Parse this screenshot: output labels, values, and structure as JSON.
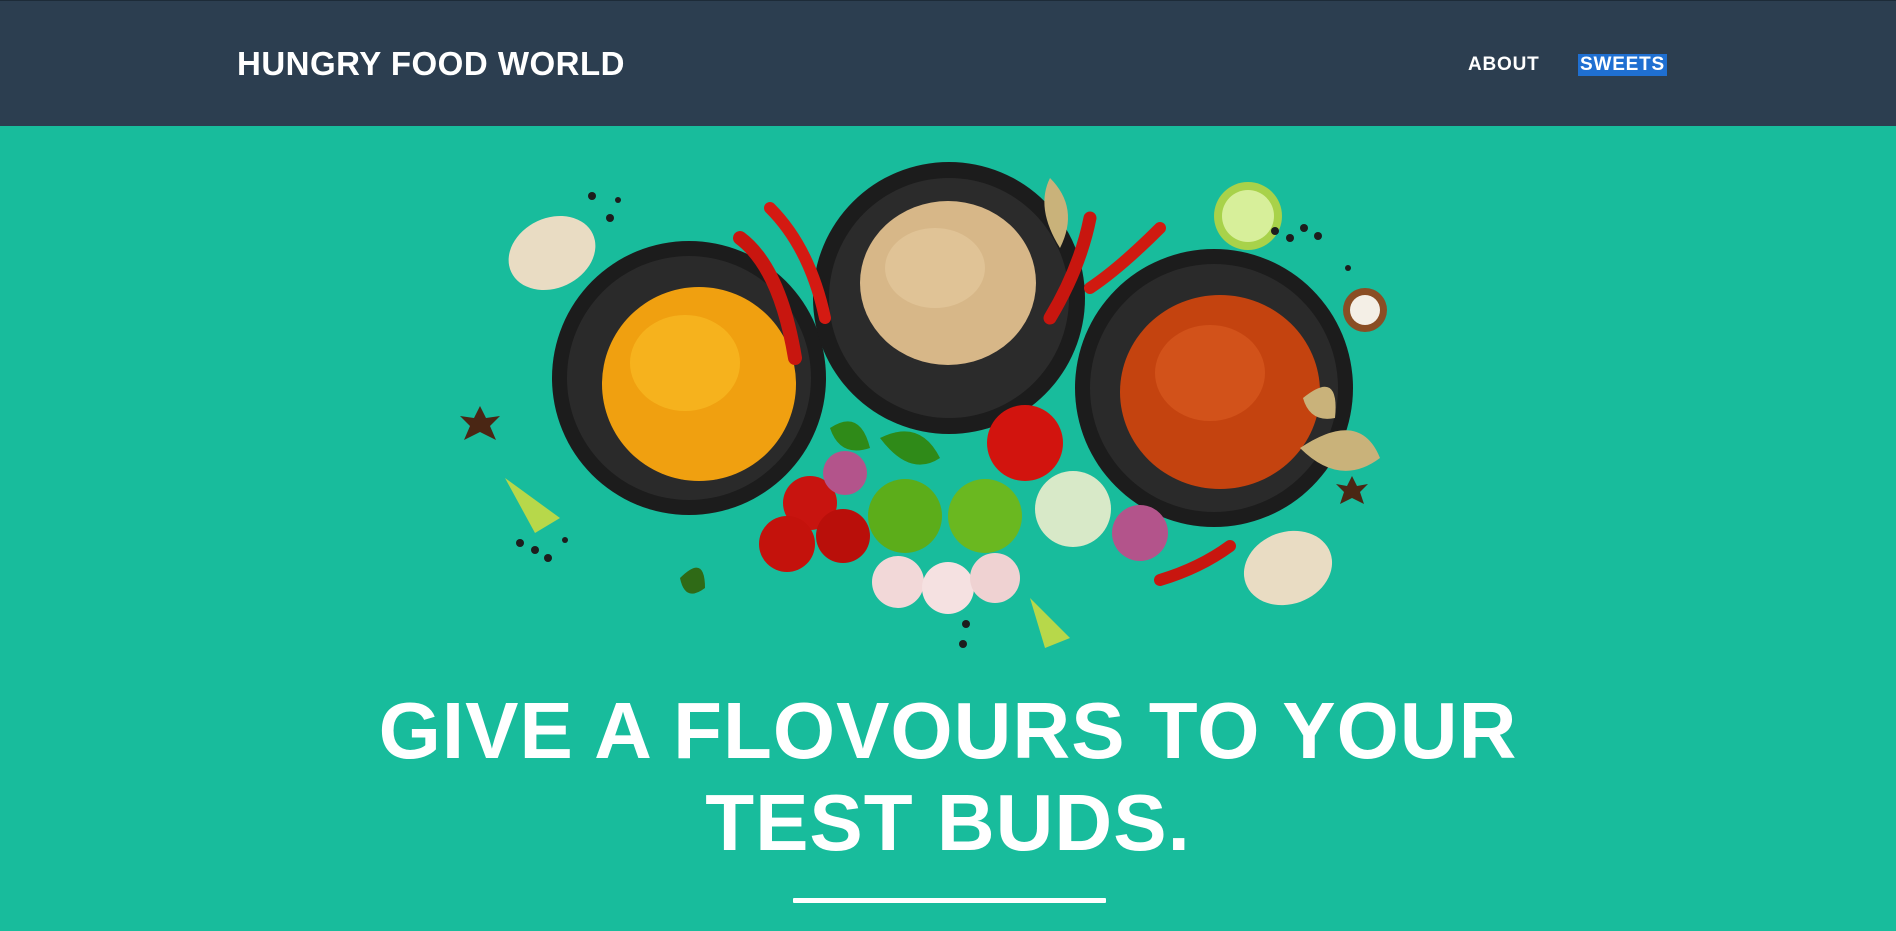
{
  "navbar": {
    "brand": "HUNGRY FOOD WORLD",
    "links": [
      {
        "label": "ABOUT",
        "selected": false
      },
      {
        "label": "SWEETS",
        "selected": true
      }
    ]
  },
  "hero": {
    "image": "spices-and-vegetables-illustration",
    "heading_line1": "GIVE A FLOVOURS TO YOUR",
    "heading_line2": "TEST BUDS."
  },
  "colors": {
    "navbar": "#2c3e50",
    "background": "#18bc9c",
    "text": "#ffffff",
    "selection": "#1f6fd1"
  }
}
